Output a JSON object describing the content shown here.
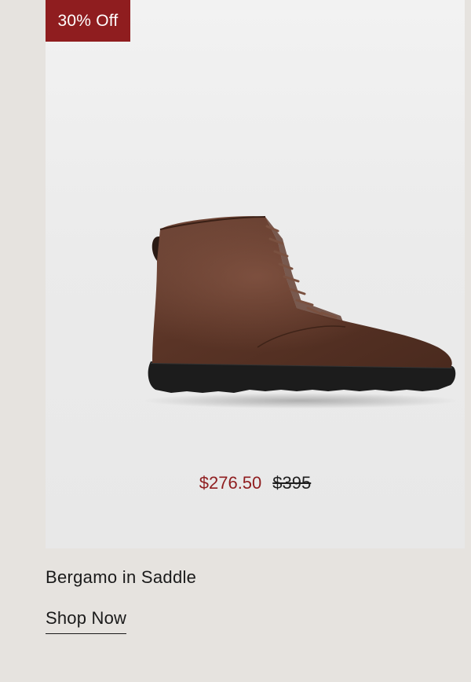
{
  "badge": {
    "label": "30% Off",
    "color": "#8f1d1f"
  },
  "product": {
    "name": "Bergamo in Saddle",
    "sale_price": "$276.50",
    "original_price": "$395",
    "image_icon": "boot-image"
  },
  "cta": {
    "label": "Shop Now"
  },
  "colors": {
    "background": "#e6e3df",
    "accent": "#8f1d1f",
    "text": "#1a1a1a"
  }
}
